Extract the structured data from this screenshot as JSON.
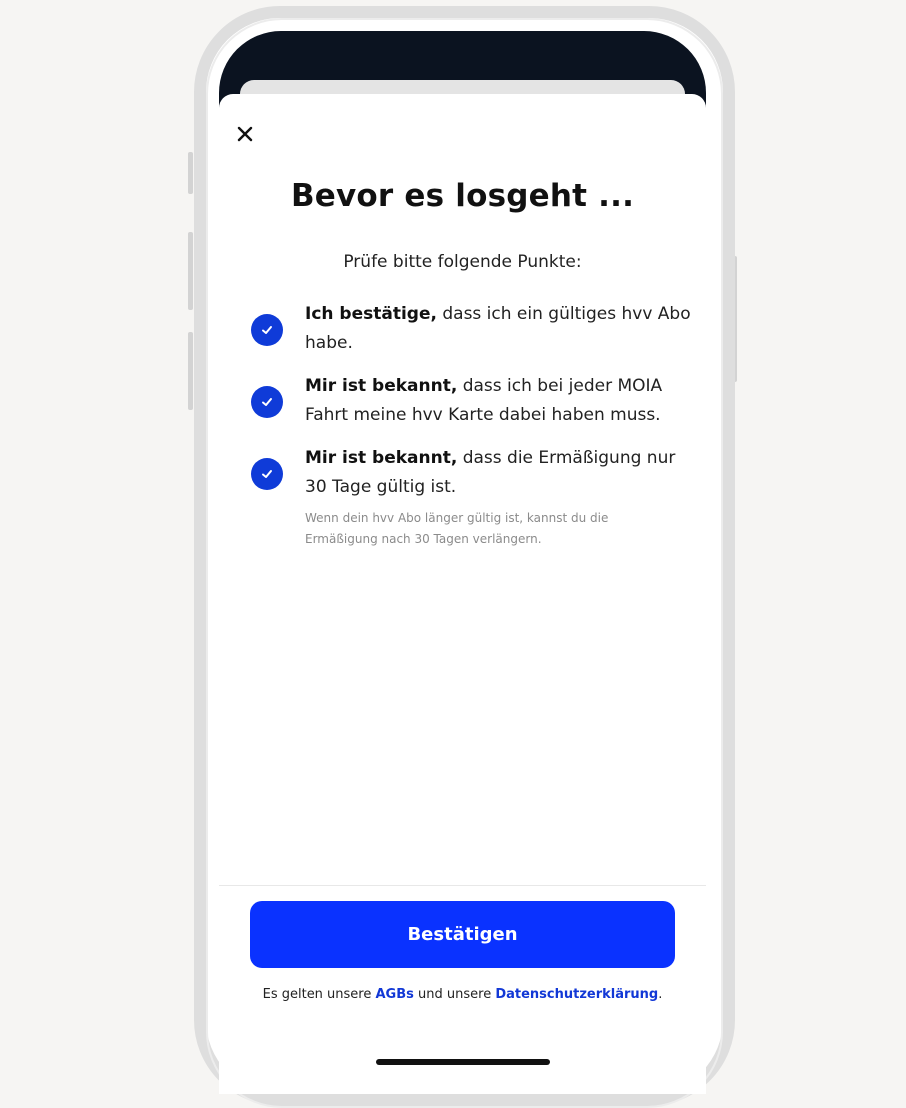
{
  "header": {
    "close_icon": "close-icon"
  },
  "main": {
    "title": "Bevor es losgeht ...",
    "subtitle": "Prüfe bitte folgende Punkte:",
    "items": [
      {
        "bold": "Ich bestätige,",
        "text": " dass ich ein gültiges hvv Abo habe.",
        "checked": true
      },
      {
        "bold": "Mir ist bekannt,",
        "text": " dass ich bei jeder MOIA Fahrt meine hvv Karte dabei haben muss.",
        "checked": true
      },
      {
        "bold": "Mir ist bekannt,",
        "text": " dass die Ermäßigung nur 30 Tage gültig ist.",
        "checked": true,
        "note": "Wenn dein hvv Abo länger gültig ist, kannst du die Ermäßigung nach 30 Tagen verlängern."
      }
    ]
  },
  "footer": {
    "confirm_label": "Bestätigen",
    "legal_prefix": "Es gelten unsere ",
    "agb_link": "AGBs",
    "legal_middle": " und unsere ",
    "privacy_link": "Datenschutzerklärung",
    "legal_suffix": "."
  },
  "colors": {
    "accent": "#0a32ff",
    "check": "#0f3bd8",
    "link": "#1238d6"
  }
}
